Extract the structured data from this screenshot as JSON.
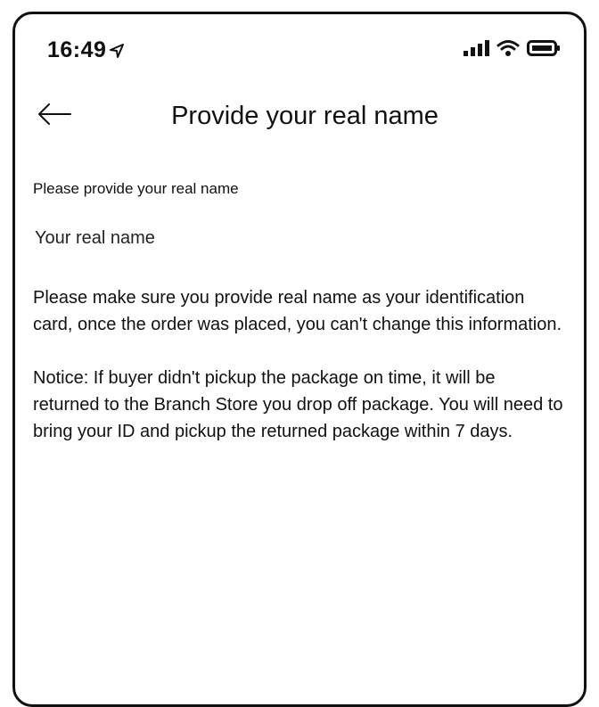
{
  "status_bar": {
    "time": "16:49",
    "icons": [
      "location-arrow-icon",
      "cellular-signal-icon",
      "wifi-icon",
      "battery-icon"
    ]
  },
  "nav": {
    "back_icon": "arrow-left-icon",
    "title": "Provide your real name"
  },
  "form": {
    "label": "Please provide your real name",
    "name_placeholder": "Your real name",
    "name_value": ""
  },
  "info": {
    "reminder": "Please make sure you provide real name as your identification card, once the order was placed, you can't change this information.",
    "notice": "Notice: If buyer didn't pickup the package on time, it will be returned to the Branch Store you drop off package. You will need to bring your ID and pickup the returned package within 7 days."
  }
}
